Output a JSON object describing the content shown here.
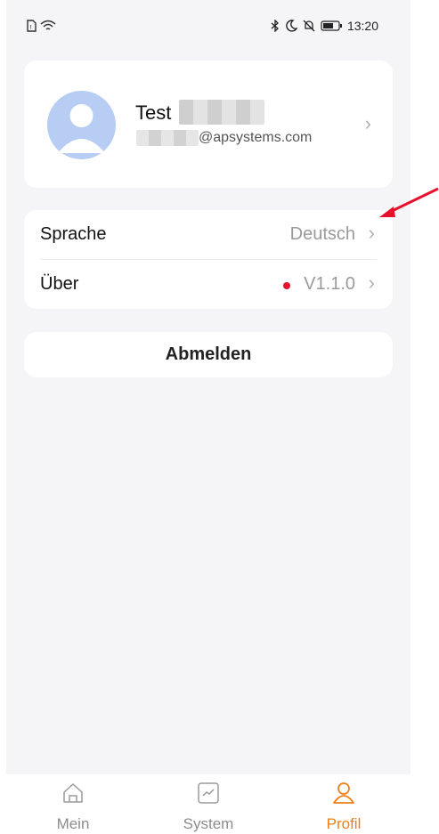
{
  "status_bar": {
    "time": "13:20",
    "icons_left": [
      "sim-icon",
      "wifi-icon"
    ],
    "icons_right": [
      "bluetooth-icon",
      "moon-icon",
      "mute-icon",
      "battery-icon"
    ]
  },
  "profile": {
    "name": "Test",
    "email": "@apsystems.com",
    "avatar_color": "#b7cdf3"
  },
  "settings": {
    "items": [
      {
        "label": "Sprache",
        "value": "Deutsch"
      },
      {
        "label": "Über",
        "value": "V1.1.0",
        "badge_color": "#e8112d"
      }
    ]
  },
  "logout": {
    "label": "Abmelden"
  },
  "tab_bar": {
    "tabs": [
      {
        "label": "Mein",
        "icon": "home-icon",
        "active": false
      },
      {
        "label": "System",
        "icon": "chart-icon",
        "active": false
      },
      {
        "label": "Profil",
        "icon": "user-icon",
        "active": true
      }
    ],
    "active_color": "#f07f1a"
  },
  "annotation": {
    "color": "#e8112d"
  }
}
